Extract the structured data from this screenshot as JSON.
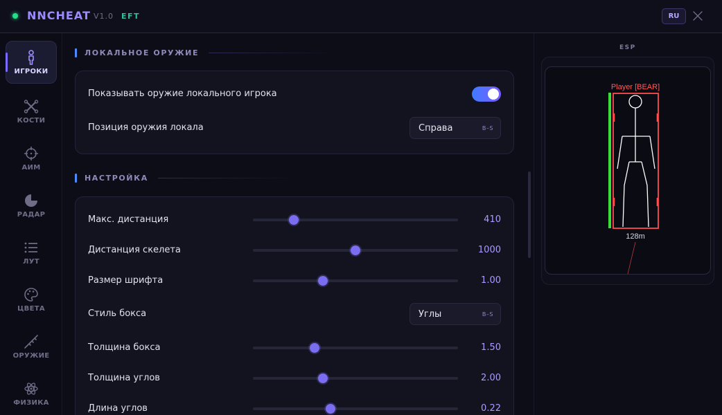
{
  "app": {
    "name": "NNCHEAT",
    "version": "V1.0",
    "game": "EFT",
    "language": "RU",
    "status_color": "#22e08a",
    "accent_color": "#7b6df0"
  },
  "sidebar": {
    "items": [
      {
        "label": "ИГРОКИ",
        "icon": "person-icon",
        "active": true
      },
      {
        "label": "КОСТИ",
        "icon": "bones-icon",
        "active": false
      },
      {
        "label": "АИМ",
        "icon": "crosshair-icon",
        "active": false
      },
      {
        "label": "РАДАР",
        "icon": "radar-icon",
        "active": false
      },
      {
        "label": "ЛУТ",
        "icon": "list-icon",
        "active": false
      },
      {
        "label": "ЦВЕТА",
        "icon": "palette-icon",
        "active": false
      },
      {
        "label": "ОРУЖИЕ",
        "icon": "rifle-icon",
        "active": false
      },
      {
        "label": "ФИЗИКА",
        "icon": "atom-icon",
        "active": false
      }
    ]
  },
  "sections": {
    "local_weapon": {
      "title": "ЛОКАЛЬНОЕ ОРУЖИЕ",
      "show_weapon": {
        "label": "Показывать оружие локального игрока",
        "enabled": true
      },
      "weapon_position": {
        "label": "Позиция оружия локала",
        "value": "Справа",
        "hint": "B–S"
      }
    },
    "settings": {
      "title": "НАСТРОЙКА",
      "max_distance": {
        "label": "Макс. дистанция",
        "value": "410",
        "fraction": 0.2
      },
      "skeleton_distance": {
        "label": "Дистанция скелета",
        "value": "1000",
        "fraction": 0.5
      },
      "font_size": {
        "label": "Размер шрифта",
        "value": "1.00",
        "fraction": 0.34
      },
      "box_style": {
        "label": "Стиль бокса",
        "value": "Углы",
        "hint": "B–S"
      },
      "box_thickness": {
        "label": "Толщина бокса",
        "value": "1.50",
        "fraction": 0.3
      },
      "corner_thickness": {
        "label": "Толщина углов",
        "value": "2.00",
        "fraction": 0.34
      },
      "corner_length": {
        "label": "Длина углов",
        "value": "0.22",
        "fraction": 0.38
      }
    }
  },
  "esp_preview": {
    "title": "ESP",
    "player_name": "Player [BEAR]",
    "distance": "128m",
    "health_fraction": 1.0,
    "box_color": "#ff4d4d",
    "health_color": "#3ddc3d",
    "name_color": "#ff5a5a",
    "skeleton_color": "#ffffff"
  }
}
